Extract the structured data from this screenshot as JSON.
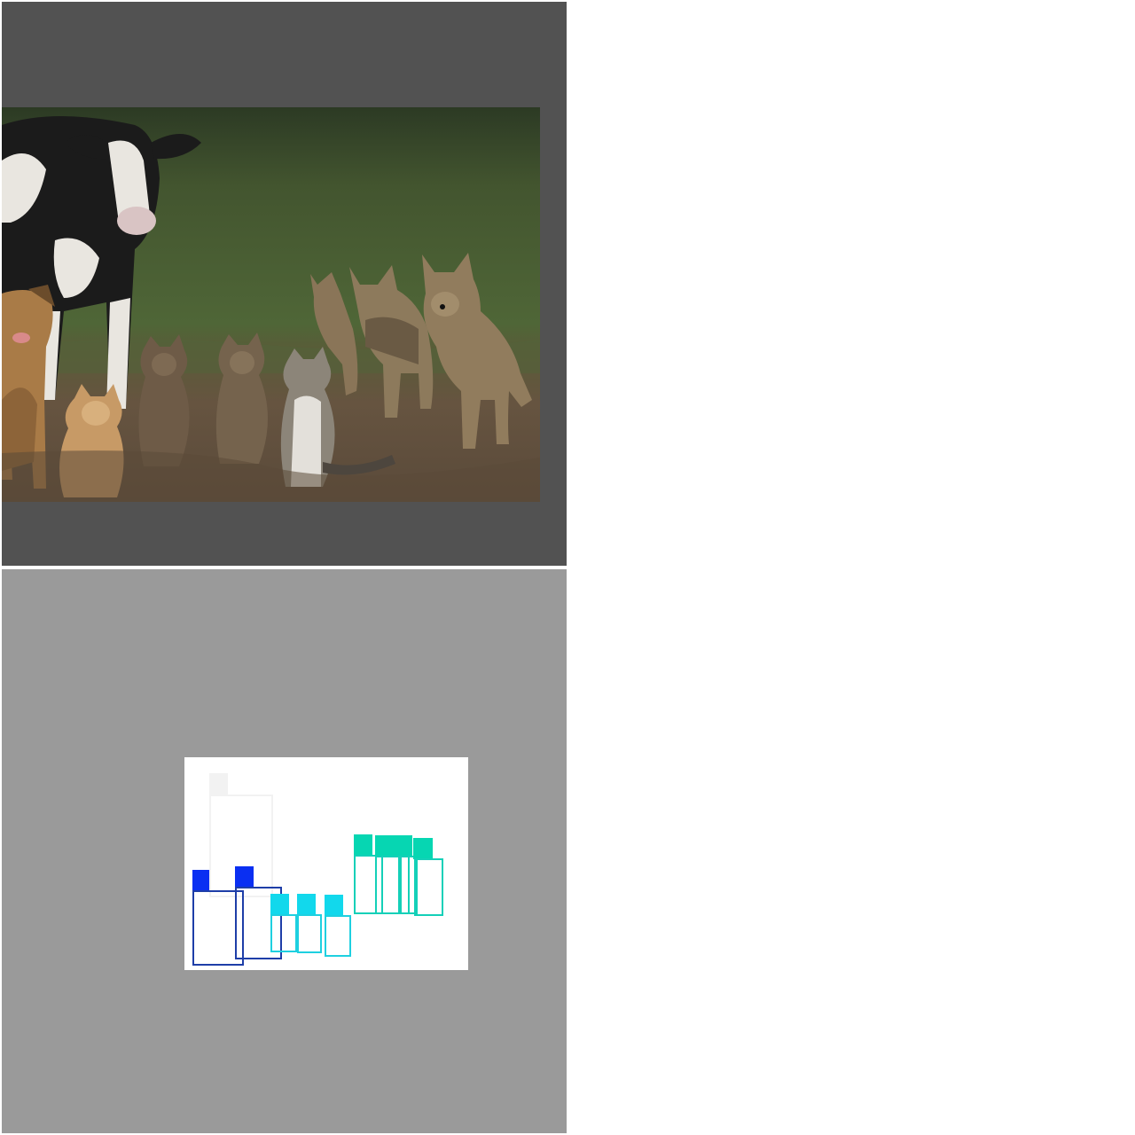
{
  "colors": {
    "top_background": "#525252",
    "bottom_background": "#9a9a9a",
    "canvas": "#ffffff",
    "cow_class": "#f2f2f2",
    "dog_class": "#1e3ea8",
    "dog_tag": "#0a2ff2",
    "cat_class": "#1ed0e0",
    "cat_tag": "#12d8ec",
    "coyote_class": "#14d0b8",
    "coyote_tag": "#06d6b2"
  },
  "scene": {
    "subjects": [
      "cow",
      "dog",
      "cat",
      "cat",
      "cat",
      "cat",
      "coyote",
      "coyote",
      "coyote",
      "coyote"
    ]
  }
}
